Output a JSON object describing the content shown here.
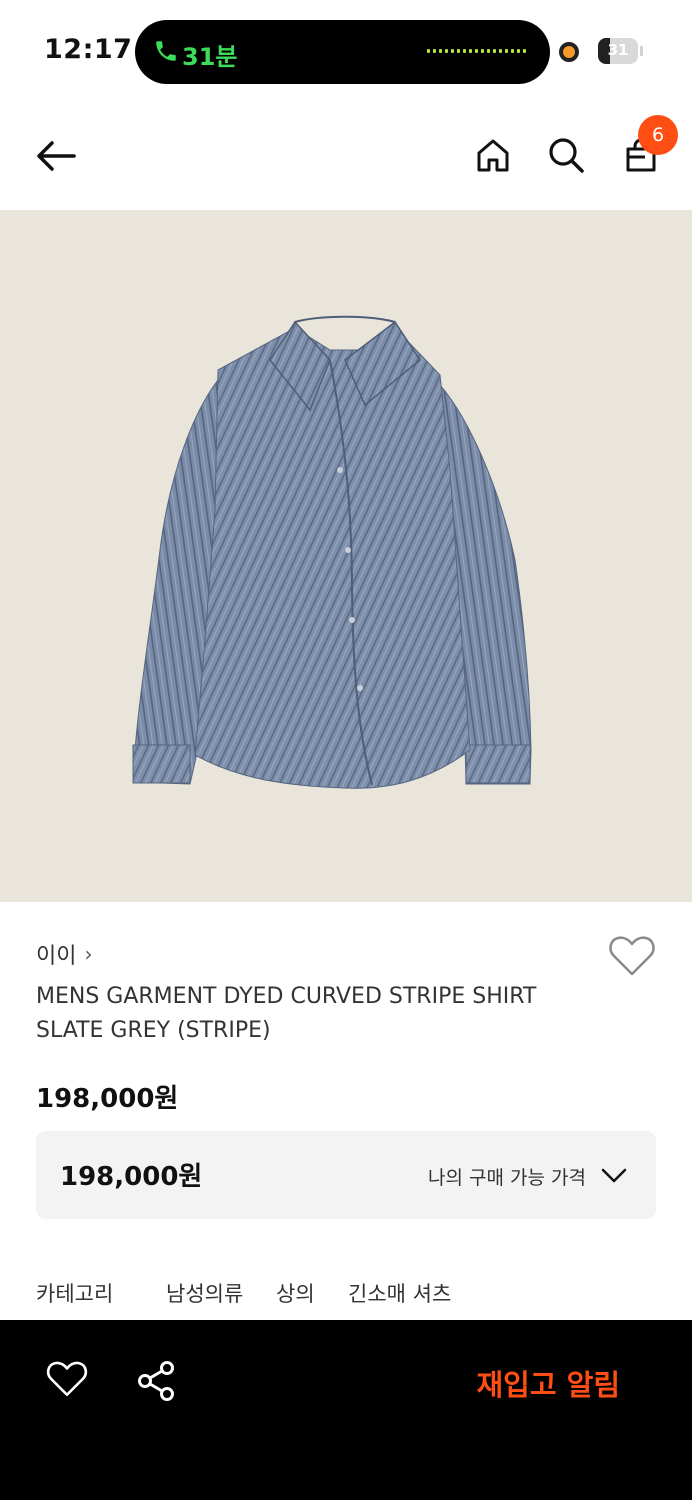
{
  "status_bar": {
    "time": "12:17",
    "call_duration": "31분",
    "battery_level": "31",
    "battery_fraction": 0.31,
    "call_color": "#3ddc5b",
    "record_dot_color": "#f59a2a"
  },
  "header": {
    "back_icon": "arrow-left-icon",
    "home_icon": "home-icon",
    "search_icon": "search-icon",
    "cart_icon": "shopping-bag-icon",
    "cart_count": "6",
    "badge_color": "#ff4e14"
  },
  "product": {
    "brand": "이이",
    "name": "MENS GARMENT DYED CURVED STRIPE SHIRT SLATE GREY (STRIPE)",
    "price": "198,000원",
    "my_price": "198,000원",
    "my_price_label": "나의 구매 가능 가격",
    "image_background": "#e9e5da",
    "shirt_color": "#7d8fab"
  },
  "category": {
    "label": "카테고리",
    "path": [
      "남성의류",
      "상의",
      "긴소매 셔츠"
    ]
  },
  "bottom_bar": {
    "heart_icon": "heart-outline-icon",
    "share_icon": "share-icon",
    "restock_label": "재입고 알림",
    "accent_color": "#ff4e14"
  }
}
